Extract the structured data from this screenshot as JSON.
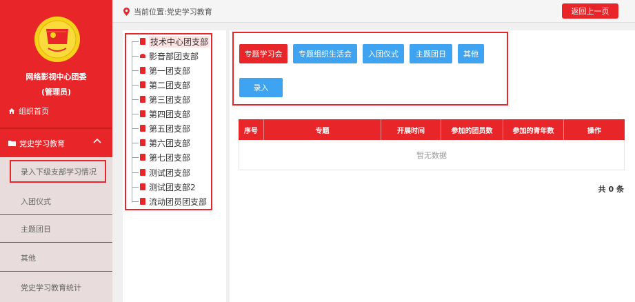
{
  "sidebar": {
    "org_name": "网络影视中心团委",
    "role": "(管理员)",
    "home": "组织首页",
    "group": "党史学习教育",
    "sub_items": [
      "录入下级支部学习情况",
      "入团仪式",
      "主题团日",
      "其他",
      "党史学习教育统计"
    ]
  },
  "topbar": {
    "location": "当前位置:党史学习教育",
    "back": "返回上一页"
  },
  "tree": {
    "items": [
      "技术中心团支部",
      "影音部团支部",
      "第一团支部",
      "第二团支部",
      "第三团支部",
      "第四团支部",
      "第五团支部",
      "第六团支部",
      "第七团支部",
      "测试团支部",
      "测试团支部2",
      "流动团员团支部"
    ]
  },
  "buttons": {
    "b1": "专题学习会",
    "b2": "专题组织生活会",
    "b3": "入团仪式",
    "b4": "主题团日",
    "b5": "其他",
    "b6": "录入"
  },
  "table": {
    "headers": [
      "序号",
      "专题",
      "开展时间",
      "参加的团员数",
      "参加的青年数",
      "操作"
    ],
    "empty": "暂无数据",
    "total": "共 0 条"
  },
  "colors": {
    "accent": "#e8262a",
    "button_blue": "#3ea3f0"
  }
}
